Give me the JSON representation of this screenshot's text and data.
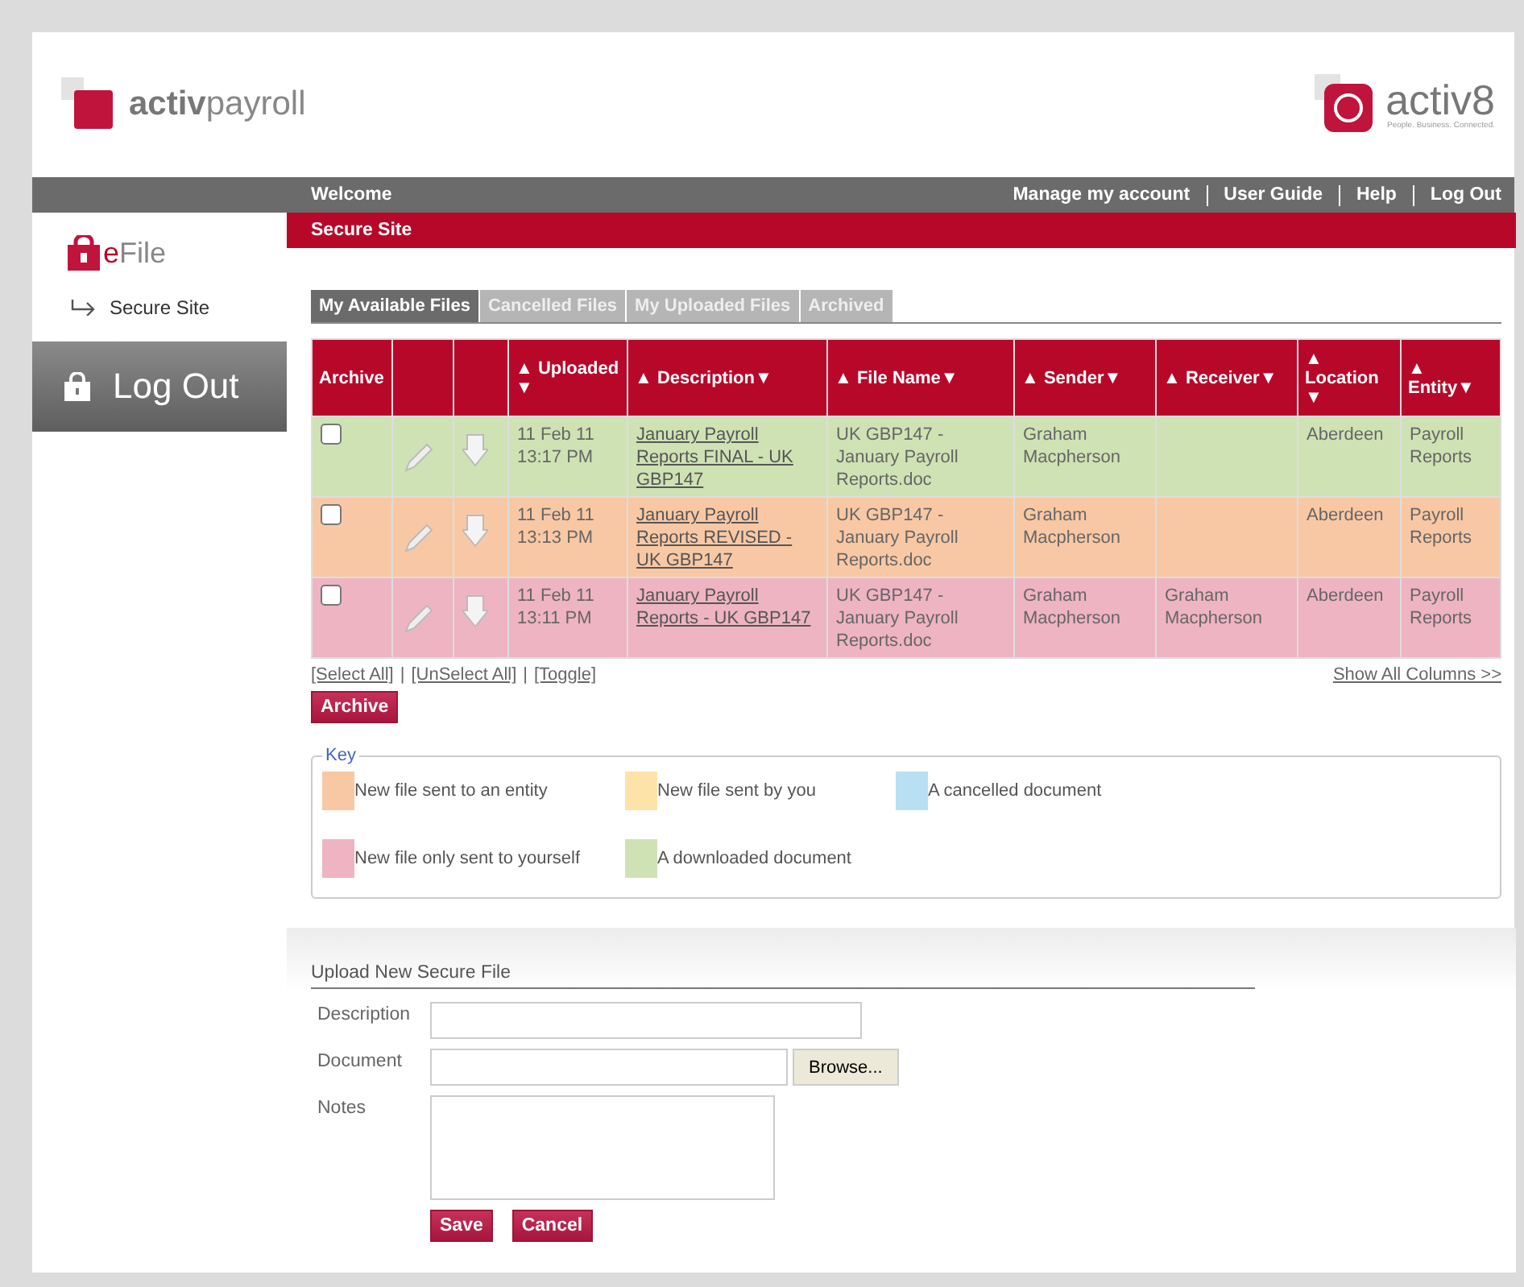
{
  "header": {
    "brand": "**activ**payroll",
    "partner_logo": {
      "name": "activ8",
      "tagline": "People. Business. Connected."
    }
  },
  "nav": {
    "welcome": "Welcome",
    "links": [
      "Manage my account",
      "User Guide",
      "Help",
      "Log Out"
    ]
  },
  "sidebar": {
    "title": "**e**File",
    "items": [
      {
        "label": "Secure Site",
        "selected": true
      }
    ],
    "logout": "Log Out"
  },
  "section_title": "Secure Site",
  "tabs": [
    {
      "label": "My Available Files",
      "selected": true
    },
    {
      "label": "Cancelled Files",
      "selected": false
    },
    {
      "label": "My Uploaded Files",
      "selected": false
    },
    {
      "label": "Archived",
      "selected": false
    }
  ],
  "table": {
    "columns": [
      "Archive",
      "",
      "",
      "▲ Uploaded ▼",
      "▲ Description▼",
      "▲ File Name▼",
      "▲ Sender▼",
      "▲ Receiver▼",
      "▲ Location ▼",
      "▲ Entity▼"
    ],
    "rows": [
      {
        "color": "#cfe2b4",
        "checked": false,
        "uploaded": "11 Feb 11 13:17 PM",
        "description": "January Payroll Reports FINAL - UK GBP147",
        "file_name": "UK GBP147 - January Payroll Reports.doc",
        "sender": "Graham Macpherson",
        "location": "Aberdeen",
        "entity": "Payroll Reports"
      },
      {
        "color": "#f8c8a4",
        "checked": false,
        "uploaded": "11 Feb 11 13:13 PM",
        "description": "January Payroll Reports REVISED - UK GBP147",
        "file_name": "UK GBP147 - January Payroll Reports.doc",
        "sender": "Graham Macpherson",
        "location": "Aberdeen",
        "entity": "Payroll Reports"
      },
      {
        "color": "#eeb4c2",
        "checked": false,
        "uploaded": "11 Feb 11 13:11 PM",
        "description": "January Payroll Reports - UK GBP147",
        "file_name": "UK GBP147 - January Payroll Reports.doc",
        "sender": "Graham Macpherson",
        "receiver": "Graham Macpherson",
        "location": "Aberdeen",
        "entity": "Payroll Reports"
      }
    ]
  },
  "selection_links": [
    "[Select All]",
    "[UnSelect All]",
    "[Toggle]"
  ],
  "link_separator": "|",
  "show_all_columns": "Show All Columns >>",
  "archive_button": "Archive",
  "key": {
    "title": "Key",
    "items": [
      {
        "label": "New file sent to an entity",
        "color": "#f8c8a4"
      },
      {
        "label": "New file sent by you",
        "color": "#fde3a8"
      },
      {
        "label": "A cancelled document",
        "color": "#b8e0f2"
      },
      {
        "label": "New file only sent to yourself",
        "color": "#eeb4c2"
      },
      {
        "label": "A downloaded document",
        "color": "#cfe2b4"
      }
    ]
  },
  "upload": {
    "title": "Upload New Secure File",
    "fields": [
      {
        "label": "Description",
        "kind": "text"
      },
      {
        "label": "Document",
        "kind": "file",
        "button": "Browse..."
      },
      {
        "label": "Notes",
        "kind": "textarea"
      }
    ],
    "buttons": [
      "Save",
      "Cancel"
    ]
  }
}
